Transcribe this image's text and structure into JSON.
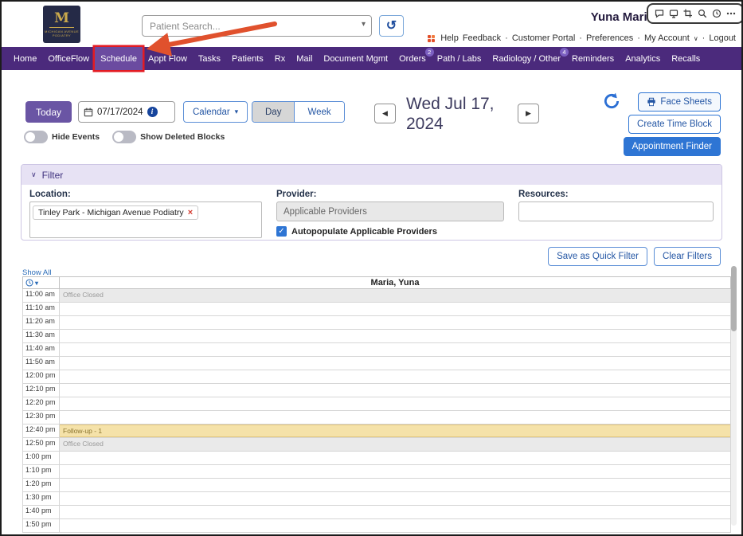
{
  "colors": {
    "nav_purple": "#4b2a7c",
    "active_tab_purple": "#6b4ba0",
    "annotation_red": "#e31b23",
    "annotation_arrow_orange": "#e0512d",
    "today_button_purple": "#6a55a4",
    "primary_blue": "#2e75d4",
    "filter_header_bg": "#e7e2f4",
    "event_closed_bg": "#eaeaea",
    "event_followup_bg": "#f5e2a9"
  },
  "icons": {
    "caret_down": "▾",
    "chevron_down": "∨",
    "prev": "◀",
    "next": "▶",
    "check": "✓",
    "remove_tag": "×",
    "history": "↺",
    "info": "i"
  },
  "header": {
    "logo": {
      "monogram": "M",
      "caption_line1": "MICHIGAN AVENUE",
      "caption_line2": "PODIATRY"
    },
    "patient_search_placeholder": "Patient Search...",
    "user_name": "Yuna Maria",
    "links": {
      "help": "Help",
      "feedback": "Feedback",
      "customer_portal": "Customer Portal",
      "preferences": "Preferences",
      "my_account": "My Account",
      "logout": "Logout",
      "separator": "·"
    }
  },
  "nav": {
    "items": [
      {
        "label": "Home"
      },
      {
        "label": "OfficeFlow"
      },
      {
        "label": "Schedule",
        "active": true
      },
      {
        "label": "Appt Flow"
      },
      {
        "label": "Tasks"
      },
      {
        "label": "Patients"
      },
      {
        "label": "Rx"
      },
      {
        "label": "Mail"
      },
      {
        "label": "Document Mgmt"
      },
      {
        "label": "Orders",
        "badge": "2"
      },
      {
        "label": "Path / Labs"
      },
      {
        "label": "Radiology / Other",
        "badge": "4"
      },
      {
        "label": "Reminders"
      },
      {
        "label": "Analytics"
      },
      {
        "label": "Recalls"
      }
    ]
  },
  "toolbar": {
    "today_label": "Today",
    "date_value": "07/17/2024",
    "calendar_label": "Calendar",
    "day_label": "Day",
    "week_label": "Week",
    "hide_events_label": "Hide Events",
    "show_deleted_label": "Show Deleted Blocks",
    "current_date_line1": "Wed Jul 17,",
    "current_date_line2": "2024",
    "face_sheets_label": "Face Sheets",
    "create_time_block_label": "Create Time Block",
    "appointment_finder_label": "Appointment Finder"
  },
  "filter": {
    "title": "Filter",
    "location_label": "Location:",
    "location_tag": "Tinley Park - Michigan Avenue Podiatry",
    "provider_label": "Provider:",
    "provider_value": "Applicable Providers",
    "autopopulate_label": "Autopopulate Applicable Providers",
    "resources_label": "Resources:",
    "save_quick_filter_label": "Save as Quick Filter",
    "clear_filters_label": "Clear Filters"
  },
  "schedule": {
    "show_all_label": "Show All",
    "column_header": "Maria, Yuna",
    "rows": [
      {
        "time": "11:00 am",
        "event": "Office Closed",
        "type": "closed"
      },
      {
        "time": "11:10 am"
      },
      {
        "time": "11:20 am"
      },
      {
        "time": "11:30 am"
      },
      {
        "time": "11:40 am"
      },
      {
        "time": "11:50 am"
      },
      {
        "time": "12:00 pm"
      },
      {
        "time": "12:10 pm"
      },
      {
        "time": "12:20 pm"
      },
      {
        "time": "12:30 pm"
      },
      {
        "time": "12:40 pm",
        "event": "Follow-up - 1",
        "type": "followup"
      },
      {
        "time": "12:50 pm",
        "event": "Office Closed",
        "type": "closed"
      },
      {
        "time": "1:00 pm"
      },
      {
        "time": "1:10 pm"
      },
      {
        "time": "1:20 pm"
      },
      {
        "time": "1:30 pm"
      },
      {
        "time": "1:40 pm"
      },
      {
        "time": "1:50 pm"
      }
    ]
  }
}
